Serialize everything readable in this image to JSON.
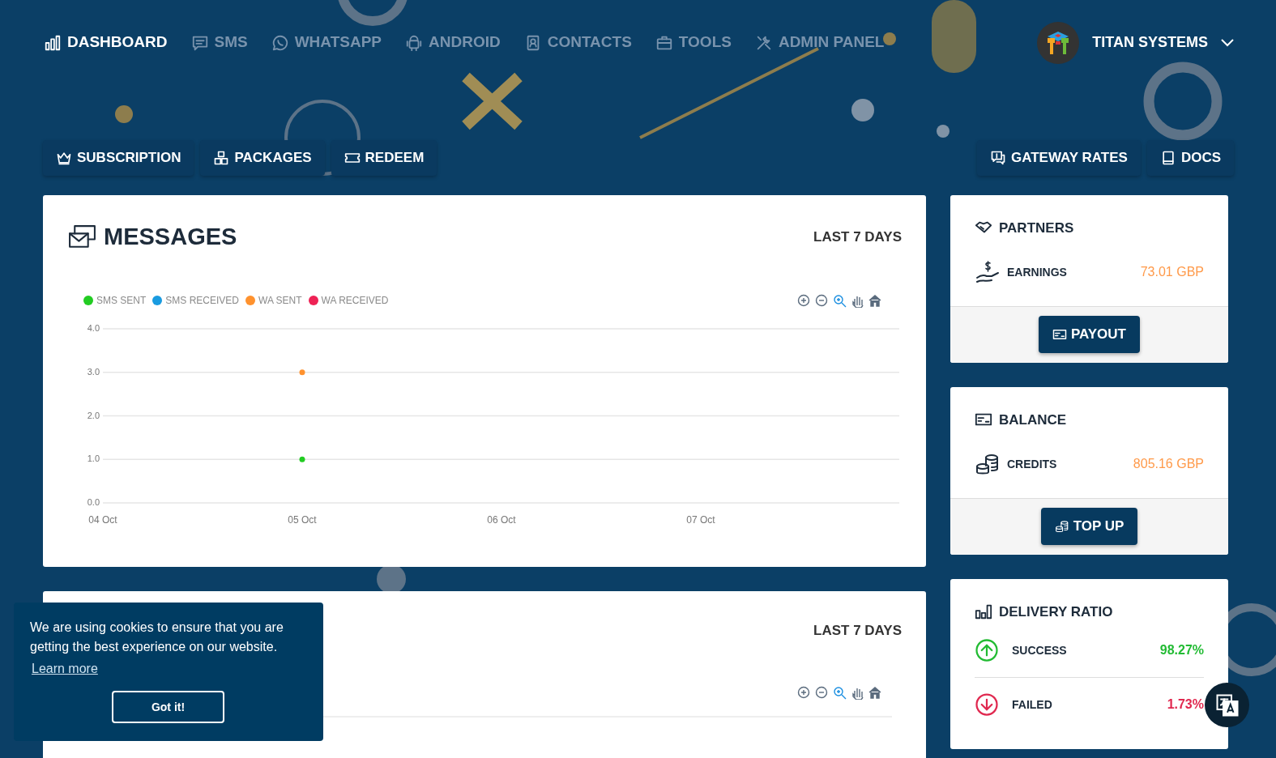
{
  "nav": {
    "items": [
      {
        "label": "DASHBOARD",
        "selected": true
      },
      {
        "label": "SMS",
        "selected": false
      },
      {
        "label": "WHATSAPP",
        "selected": false
      },
      {
        "label": "ANDROID",
        "selected": false
      },
      {
        "label": "CONTACTS",
        "selected": false
      },
      {
        "label": "TOOLS",
        "selected": false
      },
      {
        "label": "ADMIN PANEL",
        "selected": false
      }
    ]
  },
  "account": {
    "name": "TITAN SYSTEMS"
  },
  "actions_left": [
    "SUBSCRIPTION",
    "PACKAGES",
    "REDEEM"
  ],
  "actions_right": [
    "GATEWAY RATES",
    "DOCS"
  ],
  "messages_card": {
    "title": "MESSAGES",
    "period": "LAST 7 DAYS",
    "chart_data": {
      "type": "line",
      "grid": true,
      "categories": [
        "04 Oct",
        "05 Oct",
        "06 Oct",
        "07 Oct"
      ],
      "ylim": [
        0,
        4
      ],
      "yticks": [
        {
          "value": 0,
          "label": "0.0"
        },
        {
          "value": 1,
          "label": "1.0"
        },
        {
          "value": 2,
          "label": "2.0"
        },
        {
          "value": 3,
          "label": "3.0"
        },
        {
          "value": 4,
          "label": "4.0"
        }
      ],
      "series": [
        {
          "name": "SMS SENT",
          "color": "#22cc22",
          "marker": true,
          "values": [
            null,
            1,
            null,
            null
          ]
        },
        {
          "name": "SMS RECEIVED",
          "color": "#1a9be0",
          "values": [
            null,
            null,
            null,
            null
          ]
        },
        {
          "name": "WA SENT",
          "color": "#ff922e",
          "marker": true,
          "values": [
            null,
            3,
            null,
            null
          ]
        },
        {
          "name": "WA RECEIVED",
          "color": "#ee2255",
          "values": [
            null,
            null,
            null,
            null
          ]
        }
      ]
    }
  },
  "second_card": {
    "period": "LAST 7 DAYS"
  },
  "partners": {
    "title": "PARTNERS",
    "label": "EARNINGS",
    "value": "73.01 GBP",
    "button": "PAYOUT"
  },
  "balance": {
    "title": "BALANCE",
    "label": "CREDITS",
    "value": "805.16 GBP",
    "button": "TOP UP"
  },
  "delivery": {
    "title": "DELIVERY RATIO",
    "rows": [
      {
        "kind": "up",
        "label": "SUCCESS",
        "value": "98.27%"
      },
      {
        "kind": "down",
        "label": "FAILED",
        "value": "1.73%"
      }
    ]
  },
  "cookie": {
    "text": "We are using cookies to ensure that you are getting the best experience on our website.",
    "link": "Learn more",
    "button": "Got it!"
  }
}
